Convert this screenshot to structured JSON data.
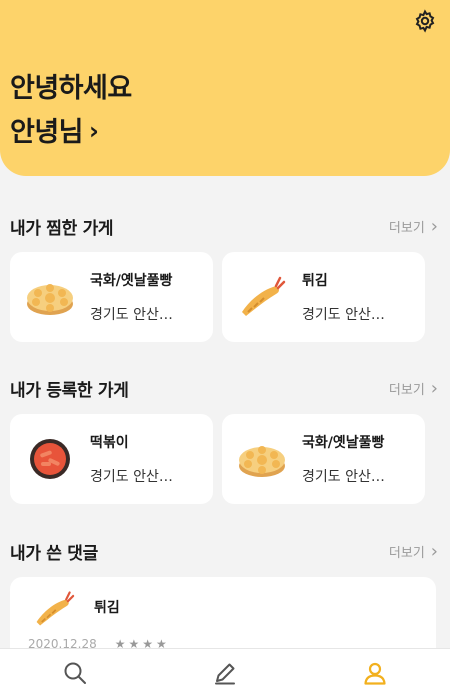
{
  "header": {
    "greeting": "안녕하세요",
    "username": "안녕님",
    "username_chevron": "›",
    "settings_icon": "gear-icon"
  },
  "sections": {
    "favorites": {
      "title": "내가 찜한 가게",
      "more_label": "더보기",
      "more_chevron": "›",
      "items": [
        {
          "name": "국화/옛날풀빵",
          "address": "경기도 안산…",
          "icon": "bungeoppang-icon"
        },
        {
          "name": "튀김",
          "address": "경기도 안산…",
          "icon": "fried-shrimp-icon"
        }
      ]
    },
    "registered": {
      "title": "내가 등록한 가게",
      "more_label": "더보기",
      "more_chevron": "›",
      "items": [
        {
          "name": "떡볶이",
          "address": "경기도 안산…",
          "icon": "tteokbokki-icon"
        },
        {
          "name": "국화/옛날풀빵",
          "address": "경기도 안산…",
          "icon": "bungeoppang-icon"
        }
      ]
    },
    "comments": {
      "title": "내가 쓴 댓글",
      "more_label": "더보기",
      "more_chevron": "›",
      "items": [
        {
          "name": "튀김",
          "date": "2020.12.28",
          "stars": "★★★★",
          "icon": "fried-shrimp-icon"
        }
      ]
    }
  },
  "bottom_nav": {
    "items": [
      "search-icon",
      "pencil-icon",
      "profile-icon"
    ],
    "active": "profile-icon",
    "active_color": "#f2b01e",
    "inactive_color": "#666666"
  },
  "colors": {
    "header_bg": "#fdd36a",
    "page_bg": "#f3f3f3",
    "card_bg": "#ffffff"
  }
}
